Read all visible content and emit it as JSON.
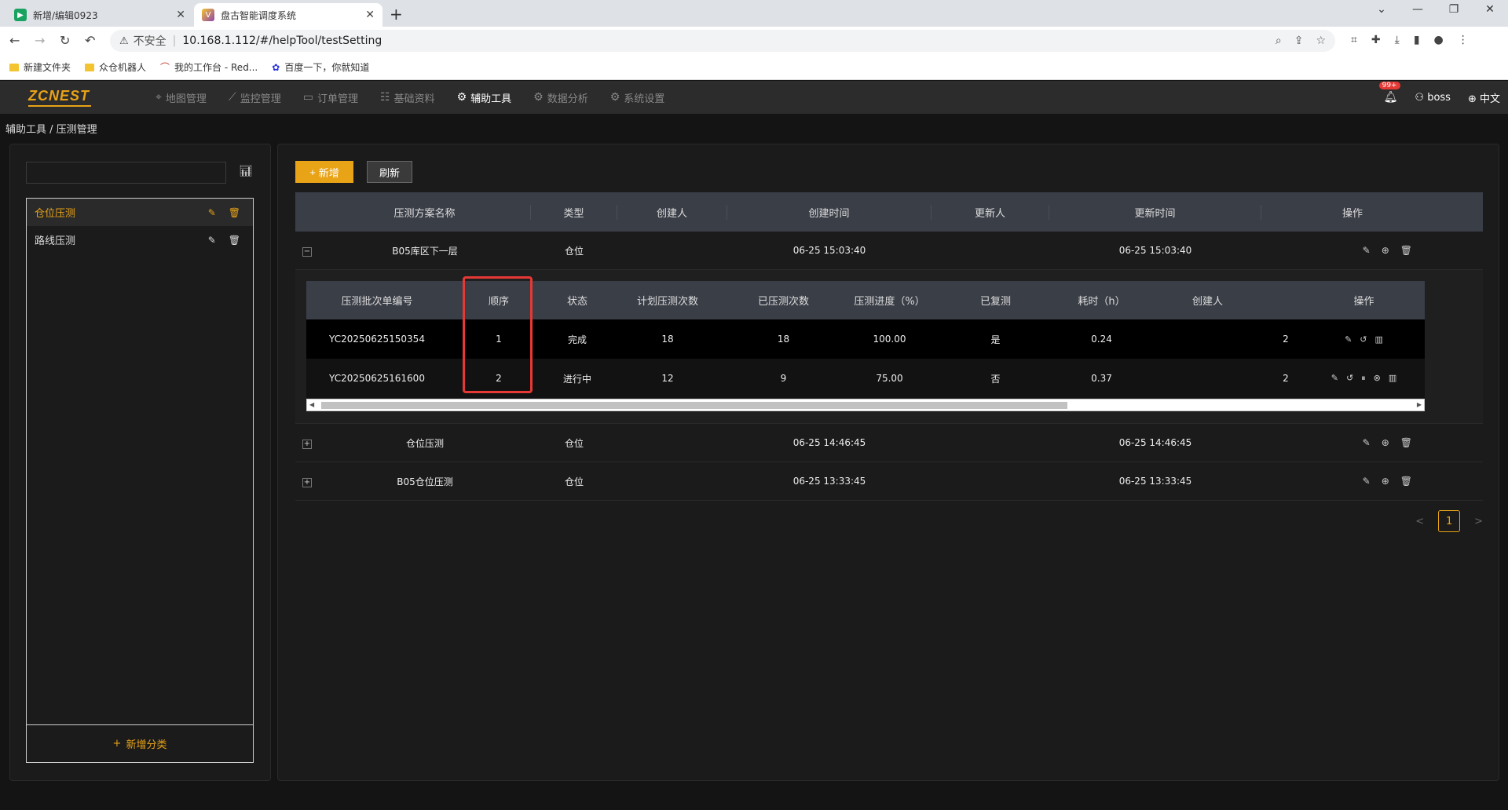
{
  "browser": {
    "tabs": [
      {
        "title": "新增/编辑0923"
      },
      {
        "title": "盘古智能调度系统"
      }
    ],
    "url_warning": "不安全",
    "url": "10.168.1.112/#/helpTool/testSetting",
    "bookmarks": [
      "新建文件夹",
      "众仓机器人",
      "我的工作台 - Red...",
      "百度一下，你就知道"
    ]
  },
  "app": {
    "logo": "ZCNEST",
    "nav": [
      "地图管理",
      "监控管理",
      "订单管理",
      "基础资料",
      "辅助工具",
      "数据分析",
      "系统设置"
    ],
    "active_nav": "辅助工具",
    "badge": "99+",
    "user": "boss",
    "language": "中文"
  },
  "breadcrumb": "辅助工具 / 压测管理",
  "left": {
    "search_placeholder": "",
    "categories": [
      "仓位压测",
      "路线压测"
    ],
    "add_category": "新增分类"
  },
  "toolbar": {
    "add": "新增",
    "refresh": "刷新"
  },
  "main_table": {
    "headers": [
      "压测方案名称",
      "类型",
      "创建人",
      "创建时间",
      "更新人",
      "更新时间",
      "操作"
    ],
    "rows": [
      {
        "name": "B05库区下一层",
        "type": "仓位",
        "creator": "",
        "created": "06-25 15:03:40",
        "updater": "",
        "updated": "06-25 15:03:40",
        "expanded": true
      },
      {
        "name": "仓位压测",
        "type": "仓位",
        "creator": "",
        "created": "06-25 14:46:45",
        "updater": "",
        "updated": "06-25 14:46:45",
        "expanded": false
      },
      {
        "name": "B05仓位压测",
        "type": "仓位",
        "creator": "",
        "created": "06-25 13:33:45",
        "updater": "",
        "updated": "06-25 13:33:45",
        "expanded": false
      }
    ]
  },
  "sub_table": {
    "headers": [
      "压测批次单编号",
      "顺序",
      "状态",
      "计划压测次数",
      "已压测次数",
      "压测进度（%）",
      "已复测",
      "耗时（h）",
      "创建人",
      "",
      "操作"
    ],
    "rows": [
      {
        "batch": "YC20250625150354",
        "order": "1",
        "status": "完成",
        "planned": "18",
        "done": "18",
        "progress": "100.00",
        "retested": "是",
        "duration": "0.24",
        "creator": "",
        "extra": "2"
      },
      {
        "batch": "YC20250625161600",
        "order": "2",
        "status": "进行中",
        "planned": "12",
        "done": "9",
        "progress": "75.00",
        "retested": "否",
        "duration": "0.37",
        "creator": "",
        "extra": "2"
      }
    ]
  },
  "pagination": {
    "current": "1",
    "prev": "<",
    "next": ">"
  }
}
